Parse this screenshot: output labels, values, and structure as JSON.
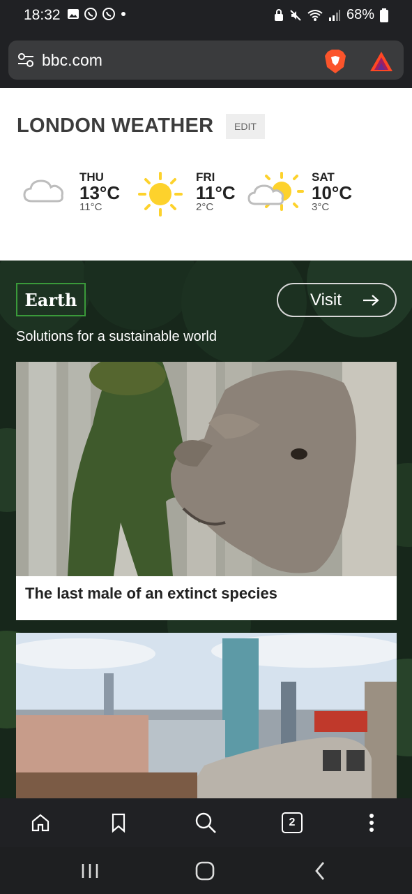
{
  "status_bar": {
    "time": "18:32",
    "battery": "68%"
  },
  "browser": {
    "url": "bbc.com",
    "tab_count": "2"
  },
  "weather": {
    "title": "LONDON WEATHER",
    "edit_label": "EDIT",
    "days": [
      {
        "day": "THU",
        "high": "13°C",
        "low": "11°C",
        "icon": "cloud-icon"
      },
      {
        "day": "FRI",
        "high": "11°C",
        "low": "2°C",
        "icon": "sun-icon"
      },
      {
        "day": "SAT",
        "high": "10°C",
        "low": "3°C",
        "icon": "sun-cloud-icon"
      }
    ]
  },
  "earth": {
    "badge": "Earth",
    "visit_label": "Visit",
    "tagline": "Solutions for a sustainable world",
    "stories": [
      {
        "caption": "The last male of an extinct species",
        "image": "rhino-photo"
      },
      {
        "image": "city-train-photo"
      }
    ]
  },
  "colors": {
    "earth_accent": "#3a9a3a",
    "background_dark": "#202124"
  }
}
